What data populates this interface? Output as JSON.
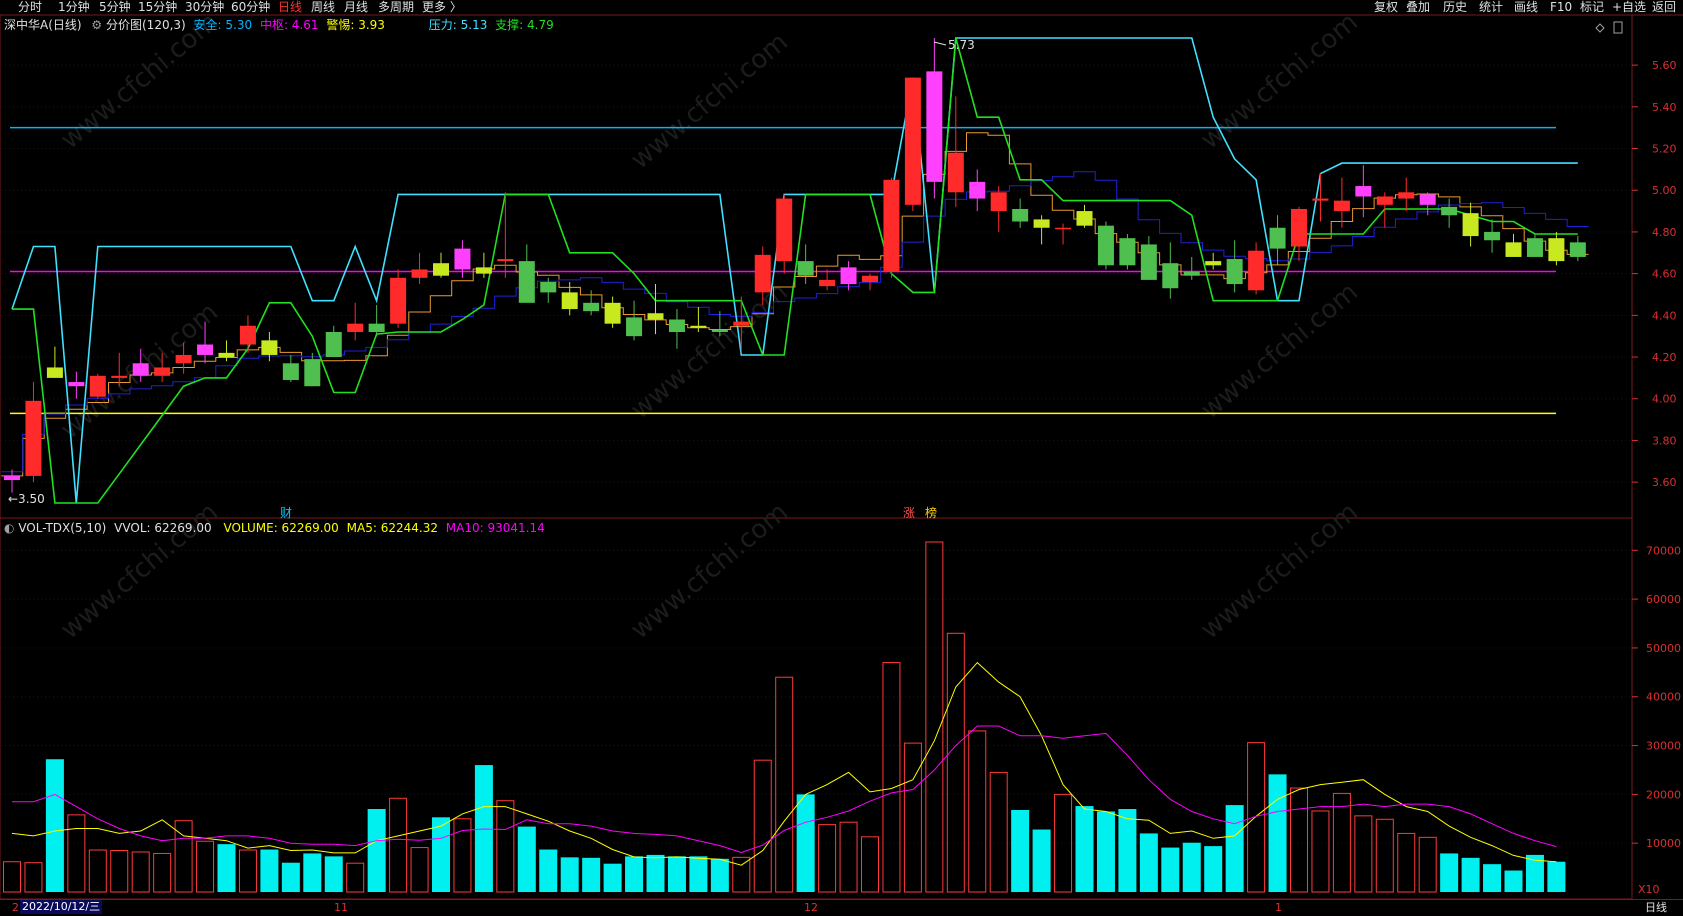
{
  "toolbar_left": [
    {
      "label": "分时",
      "active": false
    },
    {
      "label": "1分钟",
      "active": false
    },
    {
      "label": "5分钟",
      "active": false
    },
    {
      "label": "15分钟",
      "active": false
    },
    {
      "label": "30分钟",
      "active": false
    },
    {
      "label": "60分钟",
      "active": false
    },
    {
      "label": "日线",
      "active": true
    },
    {
      "label": "周线",
      "active": false
    },
    {
      "label": "月线",
      "active": false
    },
    {
      "label": "多周期",
      "active": false
    },
    {
      "label": "更多 〉",
      "active": false
    }
  ],
  "toolbar_right": [
    "复权",
    "叠加",
    "历史",
    "统计",
    "画线",
    "F10",
    "标记",
    "+自选",
    "返回"
  ],
  "legend_main": {
    "stock": "深中华A(日线)",
    "indicator": "分价图(120,3)",
    "safe_label": "安全: 5.30",
    "center_label": "中枢: 4.61",
    "alert_label": "警惕: 3.93",
    "pressure_label": "压力: 5.13",
    "support_label": "支撑: 4.79"
  },
  "legend_vol": {
    "name": "VOL-TDX(5,10)",
    "vvol": "VVOL: 62269.00",
    "volume": "VOLUME: 62269.00",
    "ma5": "MA5: 62244.32",
    "ma10": "MA10: 93041.14"
  },
  "price_axis": {
    "ticks": [
      "5.60",
      "5.40",
      "5.20",
      "5.00",
      "4.80",
      "4.60",
      "4.40",
      "4.20",
      "4.00",
      "3.80",
      "3.60"
    ],
    "min": 3.5,
    "max": 5.73
  },
  "vol_axis": {
    "ticks": [
      "70000",
      "60000",
      "50000",
      "40000",
      "30000",
      "20000",
      "10000"
    ],
    "unit": "X10"
  },
  "annotations": {
    "high": "5.73",
    "low": "←3.50",
    "event1": "财",
    "event2": "涨",
    "event3": "榜"
  },
  "date_axis": {
    "cursor_date": "2022/10/12/三",
    "month_11": "11",
    "month_12": "12",
    "month_1": "1",
    "first": "2"
  },
  "period_label": "日线",
  "watermark": "www.cfchi.com",
  "colors": {
    "up": "#ff2a2a",
    "down": "#54ff54",
    "safe": "#00b4ff",
    "center": "#ff00ff",
    "alert": "#ffff00",
    "pressure": "#40e0ff",
    "support": "#20e020"
  },
  "chart_data": {
    "type": "candlestick",
    "levels": {
      "safe": 5.3,
      "center": 4.61,
      "alert": 3.93
    },
    "candles": [
      {
        "o": 3.61,
        "h": 3.66,
        "l": 3.55,
        "c": 3.63
      },
      {
        "o": 3.63,
        "h": 4.08,
        "l": 3.6,
        "c": 3.99
      },
      {
        "o": 4.15,
        "h": 4.25,
        "l": 4.1,
        "c": 4.1
      },
      {
        "o": 4.06,
        "h": 4.13,
        "l": 4.0,
        "c": 4.08
      },
      {
        "o": 4.01,
        "h": 4.12,
        "l": 4.0,
        "c": 4.11
      },
      {
        "o": 4.1,
        "h": 4.22,
        "l": 4.06,
        "c": 4.11
      },
      {
        "o": 4.11,
        "h": 4.24,
        "l": 4.08,
        "c": 4.17
      },
      {
        "o": 4.11,
        "h": 4.22,
        "l": 4.08,
        "c": 4.15
      },
      {
        "o": 4.17,
        "h": 4.27,
        "l": 4.12,
        "c": 4.21
      },
      {
        "o": 4.21,
        "h": 4.37,
        "l": 4.17,
        "c": 4.26
      },
      {
        "o": 4.22,
        "h": 4.28,
        "l": 4.18,
        "c": 4.2
      },
      {
        "o": 4.26,
        "h": 4.4,
        "l": 4.22,
        "c": 4.35
      },
      {
        "o": 4.28,
        "h": 4.32,
        "l": 4.18,
        "c": 4.21
      },
      {
        "o": 4.17,
        "h": 4.21,
        "l": 4.08,
        "c": 4.09
      },
      {
        "o": 4.19,
        "h": 4.22,
        "l": 4.06,
        "c": 4.06
      },
      {
        "o": 4.32,
        "h": 4.35,
        "l": 4.2,
        "c": 4.2
      },
      {
        "o": 4.32,
        "h": 4.46,
        "l": 4.28,
        "c": 4.36
      },
      {
        "o": 4.36,
        "h": 4.45,
        "l": 4.3,
        "c": 4.32
      },
      {
        "o": 4.36,
        "h": 4.62,
        "l": 4.34,
        "c": 4.58
      },
      {
        "o": 4.58,
        "h": 4.7,
        "l": 4.55,
        "c": 4.62
      },
      {
        "o": 4.65,
        "h": 4.7,
        "l": 4.58,
        "c": 4.59
      },
      {
        "o": 4.62,
        "h": 4.76,
        "l": 4.58,
        "c": 4.72
      },
      {
        "o": 4.63,
        "h": 4.7,
        "l": 4.58,
        "c": 4.6
      },
      {
        "o": 4.66,
        "h": 4.99,
        "l": 4.58,
        "c": 4.67
      },
      {
        "o": 4.66,
        "h": 4.74,
        "l": 4.47,
        "c": 4.46
      },
      {
        "o": 4.56,
        "h": 4.58,
        "l": 4.46,
        "c": 4.51
      },
      {
        "o": 4.51,
        "h": 4.56,
        "l": 4.4,
        "c": 4.43
      },
      {
        "o": 4.46,
        "h": 4.52,
        "l": 4.4,
        "c": 4.42
      },
      {
        "o": 4.46,
        "h": 4.49,
        "l": 4.34,
        "c": 4.36
      },
      {
        "o": 4.39,
        "h": 4.47,
        "l": 4.28,
        "c": 4.3
      },
      {
        "o": 4.41,
        "h": 4.55,
        "l": 4.31,
        "c": 4.38
      },
      {
        "o": 4.38,
        "h": 4.43,
        "l": 4.24,
        "c": 4.32
      },
      {
        "o": 4.35,
        "h": 4.44,
        "l": 4.32,
        "c": 4.34
      },
      {
        "o": 4.33,
        "h": 4.42,
        "l": 4.3,
        "c": 4.32
      },
      {
        "o": 4.35,
        "h": 4.49,
        "l": 4.22,
        "c": 4.37
      },
      {
        "o": 4.51,
        "h": 4.73,
        "l": 4.45,
        "c": 4.69
      },
      {
        "o": 4.66,
        "h": 4.98,
        "l": 4.6,
        "c": 4.96
      },
      {
        "o": 4.66,
        "h": 4.74,
        "l": 4.55,
        "c": 4.59
      },
      {
        "o": 4.54,
        "h": 4.62,
        "l": 4.52,
        "c": 4.57
      },
      {
        "o": 4.55,
        "h": 4.66,
        "l": 4.52,
        "c": 4.63
      },
      {
        "o": 4.56,
        "h": 4.6,
        "l": 4.52,
        "c": 4.59
      },
      {
        "o": 4.61,
        "h": 5.06,
        "l": 4.58,
        "c": 5.05
      },
      {
        "o": 4.93,
        "h": 5.54,
        "l": 4.9,
        "c": 5.54
      },
      {
        "o": 5.04,
        "h": 5.73,
        "l": 4.96,
        "c": 5.57
      },
      {
        "o": 4.99,
        "h": 5.45,
        "l": 4.92,
        "c": 5.18
      },
      {
        "o": 4.96,
        "h": 5.1,
        "l": 4.9,
        "c": 5.04
      },
      {
        "o": 4.9,
        "h": 5.02,
        "l": 4.8,
        "c": 4.99
      },
      {
        "o": 4.91,
        "h": 4.96,
        "l": 4.82,
        "c": 4.85
      },
      {
        "o": 4.86,
        "h": 4.88,
        "l": 4.74,
        "c": 4.82
      },
      {
        "o": 4.82,
        "h": 4.84,
        "l": 4.74,
        "c": 4.82
      },
      {
        "o": 4.9,
        "h": 4.93,
        "l": 4.82,
        "c": 4.83
      },
      {
        "o": 4.83,
        "h": 4.85,
        "l": 4.62,
        "c": 4.64
      },
      {
        "o": 4.77,
        "h": 4.79,
        "l": 4.62,
        "c": 4.64
      },
      {
        "o": 4.74,
        "h": 4.78,
        "l": 4.57,
        "c": 4.57
      },
      {
        "o": 4.65,
        "h": 4.75,
        "l": 4.48,
        "c": 4.53
      },
      {
        "o": 4.61,
        "h": 4.68,
        "l": 4.57,
        "c": 4.59
      },
      {
        "o": 4.66,
        "h": 4.7,
        "l": 4.62,
        "c": 4.64
      },
      {
        "o": 4.67,
        "h": 4.76,
        "l": 4.51,
        "c": 4.55
      },
      {
        "o": 4.52,
        "h": 4.75,
        "l": 4.5,
        "c": 4.71
      },
      {
        "o": 4.82,
        "h": 4.88,
        "l": 4.64,
        "c": 4.72
      },
      {
        "o": 4.73,
        "h": 4.92,
        "l": 4.66,
        "c": 4.91
      },
      {
        "o": 4.95,
        "h": 5.08,
        "l": 4.85,
        "c": 4.96
      },
      {
        "o": 4.9,
        "h": 5.06,
        "l": 4.82,
        "c": 4.95
      },
      {
        "o": 4.97,
        "h": 5.12,
        "l": 4.87,
        "c": 5.02
      },
      {
        "o": 4.93,
        "h": 4.99,
        "l": 4.82,
        "c": 4.97
      },
      {
        "o": 4.96,
        "h": 5.06,
        "l": 4.9,
        "c": 4.99
      },
      {
        "o": 4.93,
        "h": 4.99,
        "l": 4.88,
        "c": 4.98
      },
      {
        "o": 4.92,
        "h": 4.96,
        "l": 4.82,
        "c": 4.88
      },
      {
        "o": 4.89,
        "h": 4.94,
        "l": 4.73,
        "c": 4.78
      },
      {
        "o": 4.8,
        "h": 4.86,
        "l": 4.7,
        "c": 4.76
      },
      {
        "o": 4.75,
        "h": 4.79,
        "l": 4.68,
        "c": 4.68
      },
      {
        "o": 4.77,
        "h": 4.79,
        "l": 4.68,
        "c": 4.68
      },
      {
        "o": 4.77,
        "h": 4.8,
        "l": 4.64,
        "c": 4.66
      },
      {
        "o": 4.75,
        "h": 4.78,
        "l": 4.66,
        "c": 4.68
      }
    ],
    "volume": [
      6200,
      6000,
      27200,
      15800,
      8600,
      8500,
      8200,
      7900,
      14600,
      10400,
      9800,
      8600,
      8700,
      6000,
      7900,
      7300,
      5900,
      17000,
      19200,
      9100,
      15300,
      15000,
      26000,
      18700,
      13400,
      8700,
      7100,
      7000,
      5800,
      7300,
      7600,
      7300,
      7300,
      6800,
      7100,
      27000,
      44000,
      20000,
      13800,
      14300,
      11300,
      47000,
      30500,
      71700,
      53000,
      33000,
      24500,
      16800,
      12800,
      20000,
      17600,
      16500,
      17000,
      12000,
      9100,
      10100,
      9400,
      17800,
      30600,
      24100,
      21300,
      16600,
      20200,
      15600,
      14900,
      12000,
      11200,
      7900,
      7000,
      5700,
      4400,
      7600,
      6200
    ],
    "ma5": [
      12000,
      11500,
      12500,
      13000,
      13000,
      12000,
      12500,
      14800,
      11500,
      11000,
      10500,
      9000,
      9500,
      8500,
      8600,
      8000,
      8000,
      10500,
      11500,
      12500,
      13500,
      16000,
      17500,
      17500,
      16000,
      14500,
      12500,
      11000,
      8700,
      7200,
      7000,
      7200,
      6900,
      6700,
      5500,
      8500,
      14500,
      20000,
      22000,
      24500,
      20500,
      21200,
      23000,
      31000,
      42000,
      47000,
      43000,
      40000,
      32000,
      22000,
      17000,
      16500,
      15000,
      14700,
      12000,
      12500,
      11000,
      11500,
      15500,
      19000,
      21000,
      22000,
      22500,
      23000,
      20000,
      17500,
      16500,
      13500,
      11200,
      9500,
      7500,
      6500,
      6200
    ],
    "ma10": [
      18500,
      18500,
      20000,
      17500,
      15000,
      13000,
      11500,
      10500,
      11000,
      11000,
      11500,
      11500,
      11000,
      10000,
      9800,
      9800,
      9500,
      10500,
      10800,
      10600,
      11000,
      12600,
      12900,
      12800,
      14800,
      14000,
      14000,
      13500,
      12500,
      12000,
      11800,
      11500,
      10500,
      9500,
      8100,
      9600,
      12600,
      14300,
      15300,
      16600,
      18600,
      20300,
      21000,
      25000,
      30000,
      34000,
      34000,
      32000,
      32000,
      31500,
      32000,
      32500,
      28000,
      23000,
      19000,
      16500,
      15000,
      14000,
      15500,
      16500,
      17000,
      17500,
      17500,
      18000,
      17500,
      18000,
      18000,
      17500,
      16000,
      14000,
      12000,
      10500,
      9300
    ],
    "pressure_line": [
      4.43,
      4.73,
      4.73,
      3.5,
      4.73,
      4.73,
      4.73,
      4.73,
      4.73,
      4.73,
      4.73,
      4.73,
      4.73,
      4.73,
      4.47,
      4.47,
      4.73,
      4.47,
      4.98,
      4.98,
      4.98,
      4.98,
      4.98,
      4.98,
      4.98,
      4.98,
      4.98,
      4.98,
      4.98,
      4.98,
      4.98,
      4.98,
      4.98,
      4.98,
      4.21,
      4.21,
      4.98,
      4.98,
      4.98,
      4.98,
      4.98,
      4.98,
      5.54,
      4.51,
      5.73,
      5.73,
      5.73,
      5.73,
      5.73,
      5.73,
      5.73,
      5.73,
      5.73,
      5.73,
      5.73,
      5.73,
      5.35,
      5.15,
      5.05,
      4.47,
      4.47,
      5.08,
      5.13,
      5.13,
      5.13,
      5.13,
      5.13,
      5.13,
      5.13,
      5.13,
      5.13,
      5.13,
      5.13,
      5.13
    ],
    "support_line": [
      4.43,
      4.43,
      3.5,
      3.5,
      3.5,
      3.64,
      3.78,
      3.92,
      4.06,
      4.1,
      4.1,
      4.24,
      4.46,
      4.46,
      4.3,
      4.03,
      4.03,
      4.31,
      4.32,
      4.32,
      4.32,
      4.38,
      4.45,
      4.98,
      4.98,
      4.98,
      4.7,
      4.7,
      4.7,
      4.6,
      4.47,
      4.47,
      4.47,
      4.47,
      4.47,
      4.21,
      4.21,
      4.98,
      4.98,
      4.98,
      4.98,
      4.6,
      4.51,
      4.51,
      5.73,
      5.35,
      5.35,
      5.05,
      5.05,
      4.95,
      4.95,
      4.95,
      4.95,
      4.95,
      4.95,
      4.88,
      4.47,
      4.47,
      4.47,
      4.47,
      4.79,
      4.79,
      4.79,
      4.79,
      4.91,
      4.91,
      4.91,
      4.91,
      4.88,
      4.85,
      4.85,
      4.79,
      4.79,
      4.79
    ]
  }
}
